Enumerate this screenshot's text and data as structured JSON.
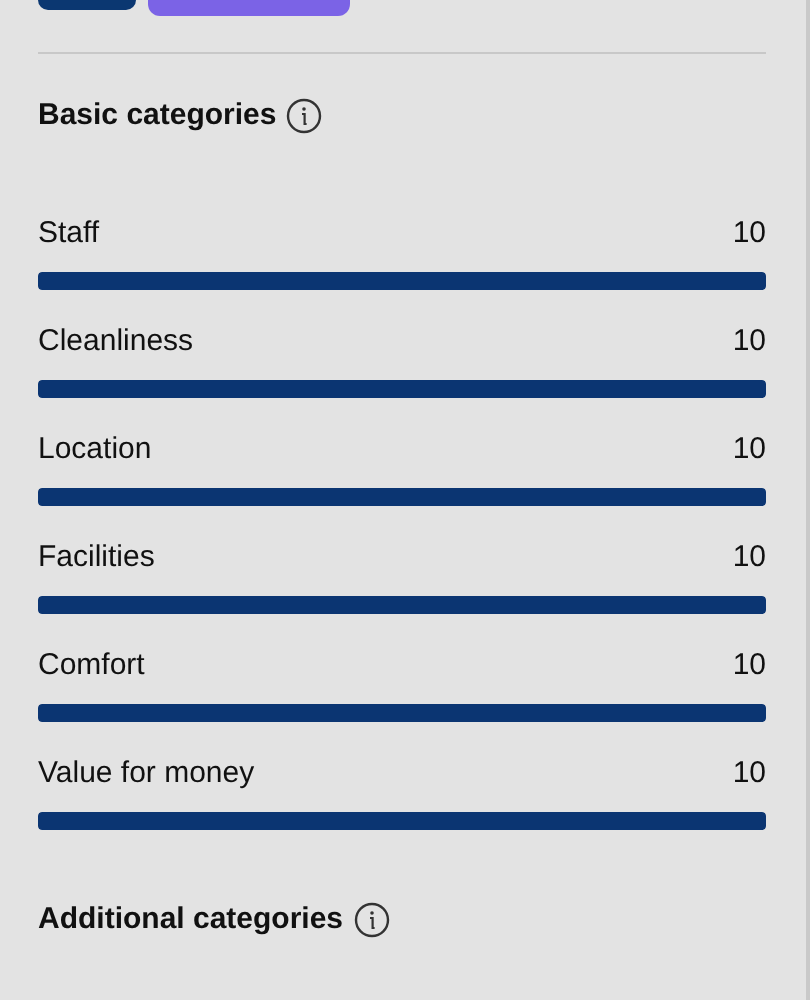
{
  "sections": [
    {
      "title": "Basic categories",
      "categories": [
        {
          "label": "Staff",
          "score": "10",
          "level": 1
        },
        {
          "label": "Cleanliness",
          "score": "10",
          "level": 1
        },
        {
          "label": "Location",
          "score": "10",
          "level": 1
        },
        {
          "label": "Facilities",
          "score": "10",
          "level": 1
        },
        {
          "label": "Comfort",
          "score": "10",
          "level": 1
        },
        {
          "label": "Value for money",
          "score": "10",
          "level": 1
        }
      ]
    },
    {
      "title": "Additional categories"
    }
  ]
}
